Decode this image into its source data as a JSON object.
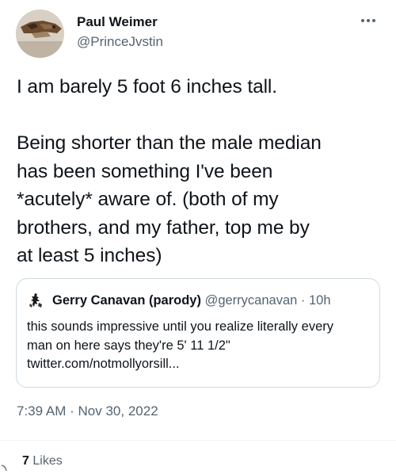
{
  "author": {
    "name": "Paul Weimer",
    "handle": "@PrinceJvstin"
  },
  "tweet": {
    "paragraphs": [
      [
        "I am barely 5 foot 6 inches tall."
      ],
      [
        "Being shorter than the male median",
        "has been something I've been",
        "*acutely* aware of. (both of my",
        "brothers, and my father, top me by",
        "at least 5 inches)"
      ]
    ]
  },
  "quote": {
    "name": "Gerry Canavan (parody)",
    "handle": "@gerrycanavan",
    "separator": "·",
    "time": "10h",
    "lines": [
      "this sounds impressive until you realize literally every",
      "man on here says they're 5' 11 1/2\"",
      "twitter.com/notmollyorsill..."
    ]
  },
  "timestamp": {
    "time": "7:39 AM",
    "separator": "·",
    "date": "Nov 30, 2022"
  },
  "likes": {
    "count": "7",
    "label": "Likes"
  },
  "icons": {
    "more": "more-horizontal-icon",
    "quote_avatar": "skeleton-avatar-icon"
  },
  "colors": {
    "text_primary": "#0f1419",
    "text_secondary": "#536471",
    "border": "#cfd9de"
  }
}
